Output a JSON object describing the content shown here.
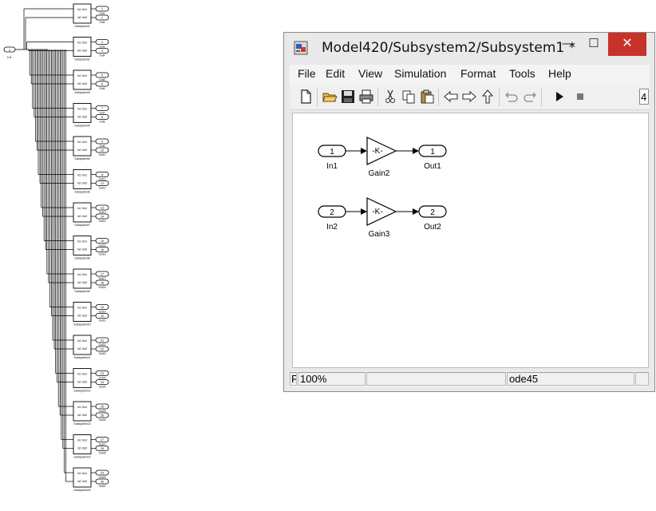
{
  "left_model": {
    "root_inport": {
      "number": "1",
      "name": "In1"
    },
    "subsystems": [
      {
        "name": "Subsystem1",
        "out_a": "1",
        "out_b": "2",
        "name_a": "Out1",
        "name_b": "Out2"
      },
      {
        "name": "Subsystem2",
        "out_a": "3",
        "out_b": "4",
        "name_a": "Out3",
        "name_b": "Out4"
      },
      {
        "name": "Subsystem3",
        "out_a": "5",
        "out_b": "6",
        "name_a": "Out5",
        "name_b": "Out6"
      },
      {
        "name": "Subsystem4",
        "out_a": "7",
        "out_b": "8",
        "name_a": "Out7",
        "name_b": "Out8"
      },
      {
        "name": "Subsystem5",
        "out_a": "9",
        "out_b": "10",
        "name_a": "Out9",
        "name_b": "Out10"
      },
      {
        "name": "Subsystem6",
        "out_a": "11",
        "out_b": "12",
        "name_a": "Out11",
        "name_b": "Out12"
      },
      {
        "name": "Subsystem7",
        "out_a": "13",
        "out_b": "14",
        "name_a": "Out13",
        "name_b": "Out14"
      },
      {
        "name": "Subsystem8",
        "out_a": "15",
        "out_b": "16",
        "name_a": "Out15",
        "name_b": "Out16"
      },
      {
        "name": "Subsystem9",
        "out_a": "17",
        "out_b": "18",
        "name_a": "Out17",
        "name_b": "Out18"
      },
      {
        "name": "Subsystem10",
        "out_a": "19",
        "out_b": "20",
        "name_a": "Out19",
        "name_b": "Out20"
      },
      {
        "name": "Subsystem11",
        "out_a": "21",
        "out_b": "22",
        "name_a": "Out21",
        "name_b": "Out22"
      },
      {
        "name": "Subsystem12",
        "out_a": "23",
        "out_b": "24",
        "name_a": "Out23",
        "name_b": "Out24"
      },
      {
        "name": "Subsystem13",
        "out_a": "25",
        "out_b": "26",
        "name_a": "Out25",
        "name_b": "Out26"
      },
      {
        "name": "Subsystem14",
        "out_a": "27",
        "out_b": "28",
        "name_a": "Out27",
        "name_b": "Out28"
      },
      {
        "name": "Subsystem15",
        "out_a": "29",
        "out_b": "30",
        "name_a": "Out29",
        "name_b": "Out30"
      }
    ],
    "port_labels": {
      "in1": "In1",
      "in2": "In2",
      "out1": "Out1",
      "out2": "Out2"
    }
  },
  "window": {
    "title": "Model420/Subsystem2/Subsystem1 *",
    "controls": {
      "minimize": "—",
      "maximize": "☐",
      "close": "✕"
    },
    "menu": [
      "File",
      "Edit",
      "View",
      "Simulation",
      "Format",
      "Tools",
      "Help"
    ],
    "toolbar_icons": [
      "new-model",
      "open-folder",
      "save",
      "print",
      "cut",
      "copy",
      "paste",
      "back",
      "forward",
      "up-level",
      "undo",
      "redo",
      "run",
      "stop"
    ],
    "stop_time": "4"
  },
  "diagram": {
    "in1": {
      "number": "1",
      "name": "In1"
    },
    "gain2": {
      "value": "-K-",
      "name": "Gain2"
    },
    "out1": {
      "number": "1",
      "name": "Out1"
    },
    "in2": {
      "number": "2",
      "name": "In2"
    },
    "gain3": {
      "value": "-K-",
      "name": "Gain3"
    },
    "out2": {
      "number": "2",
      "name": "Out2"
    }
  },
  "status": {
    "mode_char": "F",
    "zoom": "100%",
    "solver": "ode45"
  },
  "colors": {
    "close_button": "#c7322b",
    "window_frame": "#e9e9e9",
    "canvas": "#ffffff",
    "block_line": "#000000"
  }
}
